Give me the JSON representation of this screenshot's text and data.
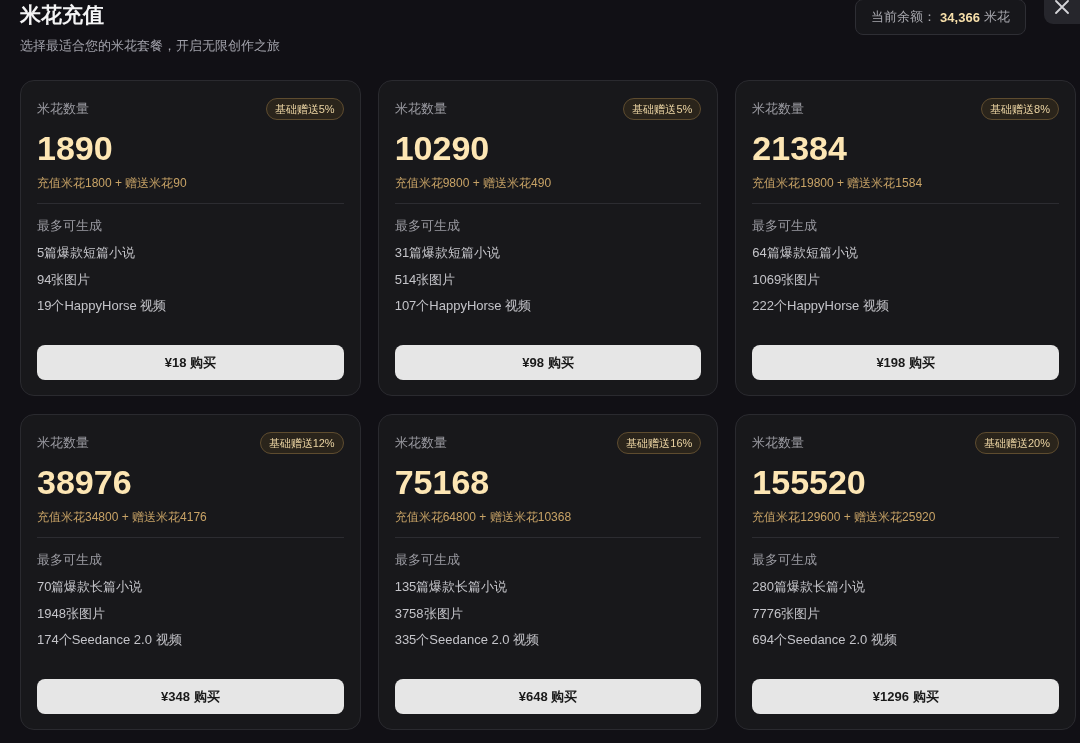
{
  "header": {
    "title": "米花充值",
    "subtitle": "选择最适合您的米花套餐，开启无限创作之旅"
  },
  "balance": {
    "label": "当前余额：",
    "amount": "34,366",
    "unit": "米花"
  },
  "packages": [
    {
      "label": "米花数量",
      "badge": "基础赠送5%",
      "amount": "1890",
      "breakdown": "充值米花1800 + 赠送米花90",
      "generate_label": "最多可生成",
      "items": [
        "5篇爆款短篇小说",
        "94张图片",
        "19个HappyHorse 视频"
      ],
      "button": "¥18 购买"
    },
    {
      "label": "米花数量",
      "badge": "基础赠送5%",
      "amount": "10290",
      "breakdown": "充值米花9800 + 赠送米花490",
      "generate_label": "最多可生成",
      "items": [
        "31篇爆款短篇小说",
        "514张图片",
        "107个HappyHorse 视频"
      ],
      "button": "¥98 购买"
    },
    {
      "label": "米花数量",
      "badge": "基础赠送8%",
      "amount": "21384",
      "breakdown": "充值米花19800 + 赠送米花1584",
      "generate_label": "最多可生成",
      "items": [
        "64篇爆款短篇小说",
        "1069张图片",
        "222个HappyHorse 视频"
      ],
      "button": "¥198 购买"
    },
    {
      "label": "米花数量",
      "badge": "基础赠送12%",
      "amount": "38976",
      "breakdown": "充值米花34800 + 赠送米花4176",
      "generate_label": "最多可生成",
      "items": [
        "70篇爆款长篇小说",
        "1948张图片",
        "174个Seedance 2.0 视频"
      ],
      "button": "¥348 购买"
    },
    {
      "label": "米花数量",
      "badge": "基础赠送16%",
      "amount": "75168",
      "breakdown": "充值米花64800 + 赠送米花10368",
      "generate_label": "最多可生成",
      "items": [
        "135篇爆款长篇小说",
        "3758张图片",
        "335个Seedance 2.0 视频"
      ],
      "button": "¥648 购买"
    },
    {
      "label": "米花数量",
      "badge": "基础赠送20%",
      "amount": "155520",
      "breakdown": "充值米花129600 + 赠送米花25920",
      "generate_label": "最多可生成",
      "items": [
        "280篇爆款长篇小说",
        "7776张图片",
        "694个Seedance 2.0 视频"
      ],
      "button": "¥1296 购买"
    }
  ]
}
